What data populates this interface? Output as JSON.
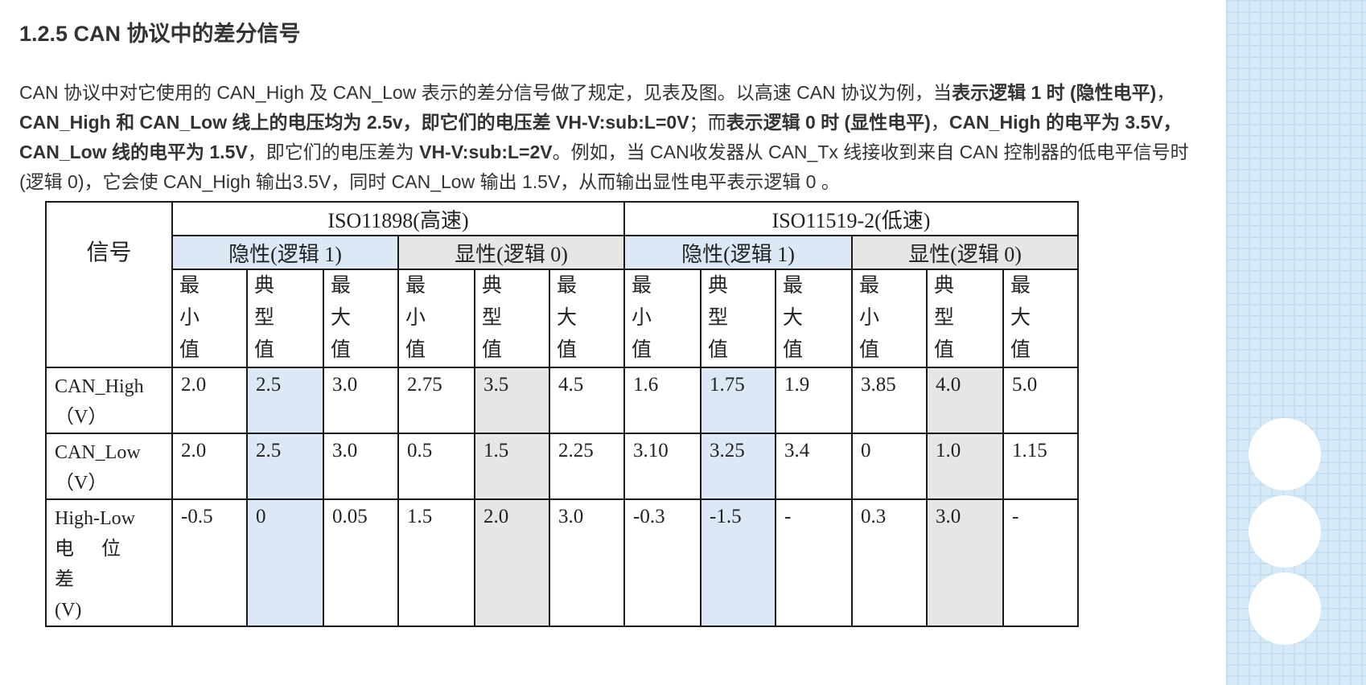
{
  "heading": "1.2.5 CAN 协议中的差分信号",
  "paragraph": [
    {
      "t": "CAN 协议中对它使用的 CAN_High 及 CAN_Low 表示的差分信号做了规定，见表及图。以高速 CAN 协议为例，当",
      "b": false
    },
    {
      "t": "表示逻辑 1 时 (隐性电平)",
      "b": true
    },
    {
      "t": "，",
      "b": false
    },
    {
      "t": "CAN_High 和 CAN_Low 线上的电压均为 2.5v，即它们的电压差 VH-V:sub:L=0V",
      "b": true
    },
    {
      "t": "；而",
      "b": false
    },
    {
      "t": "表示逻辑 0 时 (显性电平)",
      "b": true
    },
    {
      "t": "，",
      "b": false
    },
    {
      "t": "CAN_High 的电平为 3.5V，CAN_Low 线的电平为 1.5V",
      "b": true
    },
    {
      "t": "，即它们的电压差为 ",
      "b": false
    },
    {
      "t": "VH-V:sub:L=2V",
      "b": true
    },
    {
      "t": "。例如，当 CAN收发器从 CAN_Tx 线接收到来自 CAN 控制器的低电平信号时 (逻辑 0)，它会使 CAN_High 输出3.5V，同时 CAN_Low 输出 1.5V，从而输出显性电平表示逻辑 0 。",
      "b": false
    }
  ],
  "table": {
    "signal_header": "信号",
    "standards": [
      "ISO11898(高速)",
      "ISO11519-2(低速)"
    ],
    "states": [
      "隐性(逻辑 1)",
      "显性(逻辑 0)",
      "隐性(逻辑 1)",
      "显性(逻辑 0)"
    ],
    "value_headers": [
      [
        "最",
        "小",
        "值"
      ],
      [
        "典",
        "型",
        "值"
      ],
      [
        "最",
        "大",
        "值"
      ],
      [
        "最",
        "小",
        "值"
      ],
      [
        "典",
        "型",
        "值"
      ],
      [
        "最",
        "大",
        "值"
      ],
      [
        "最",
        "小",
        "值"
      ],
      [
        "典",
        "型",
        "值"
      ],
      [
        "最",
        "大",
        "值"
      ],
      [
        "最",
        "小",
        "值"
      ],
      [
        "典",
        "型",
        "值"
      ],
      [
        "最",
        "大",
        "值"
      ]
    ],
    "rows": [
      {
        "label": [
          "CAN_High",
          "（V）"
        ],
        "values": [
          "2.0",
          "2.5",
          "3.0",
          "2.75",
          "3.5",
          "4.5",
          "1.6",
          "1.75",
          "1.9",
          "3.85",
          "4.0",
          "5.0"
        ]
      },
      {
        "label": [
          "CAN_Low",
          "（V）"
        ],
        "values": [
          "2.0",
          "2.5",
          "3.0",
          "0.5",
          "1.5",
          "2.25",
          "3.10",
          "3.25",
          "3.4",
          "0",
          "1.0",
          "1.15"
        ]
      },
      {
        "label": [
          "High-Low",
          "电 位 差",
          "(V)"
        ],
        "values": [
          "-0.5",
          "0",
          "0.05",
          "1.5",
          "2.0",
          "3.0",
          "-0.3",
          "-1.5",
          "-",
          "0.3",
          "3.0",
          "-"
        ]
      }
    ]
  }
}
